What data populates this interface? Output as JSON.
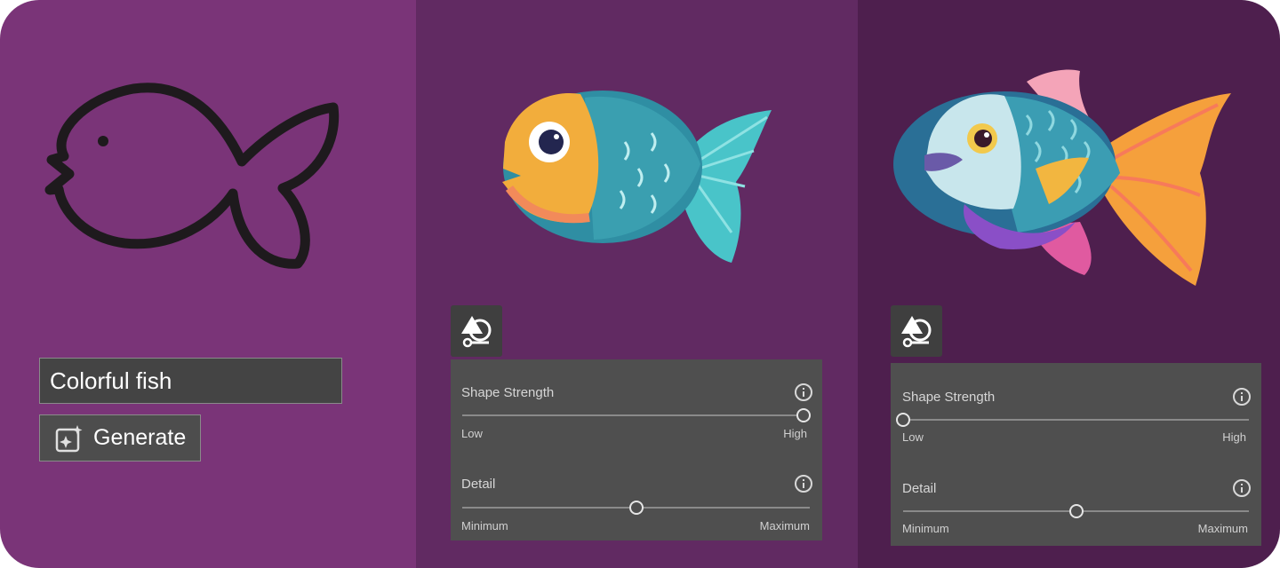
{
  "prompt": {
    "value": "Colorful fish"
  },
  "generate": {
    "label": "Generate"
  },
  "panels": [
    {
      "shape_strength": {
        "label": "Shape Strength",
        "min_label": "Low",
        "max_label": "High",
        "value": 1.0
      },
      "detail": {
        "label": "Detail",
        "min_label": "Minimum",
        "max_label": "Maximum",
        "value": 0.5
      }
    },
    {
      "shape_strength": {
        "label": "Shape Strength",
        "min_label": "Low",
        "max_label": "High",
        "value": 0.0
      },
      "detail": {
        "label": "Detail",
        "min_label": "Minimum",
        "max_label": "Maximum",
        "value": 0.5
      }
    }
  ]
}
